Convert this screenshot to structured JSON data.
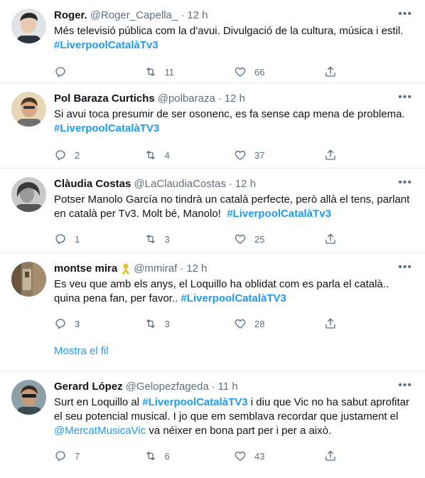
{
  "tweets": [
    {
      "name": "Roger.",
      "handle": "@Roger_Capella_",
      "dot": "·",
      "time": "12 h",
      "text_parts": [
        "Més televisió pública com la d'avui. Divulgació de la cultura, música i estil.\n"
      ],
      "hashtag": "#LiverpoolCatalàTv3",
      "replies": "",
      "retweets": "11",
      "likes": "66"
    },
    {
      "name": "Pol Baraza Curtichs",
      "handle": "@polbaraza",
      "dot": "·",
      "time": "12 h",
      "text_parts": [
        "Si avui toca presumir de ser osonenc, es fa sense cap mena de problema.\n"
      ],
      "hashtag": "#LiverpoolCatalàTV3",
      "replies": "2",
      "retweets": "4",
      "likes": "37"
    },
    {
      "name": "Clàudia Costas",
      "handle": "@LaClaudiaCostas",
      "dot": "·",
      "time": "12 h",
      "text_parts": [
        "Potser Manolo García no tindrà un català perfecte, però allà el tens, parlant en català per Tv3. Molt bé, Manolo!  "
      ],
      "hashtag": "#LiverpoolCatalàTv3",
      "replies": "1",
      "retweets": "3",
      "likes": "25"
    },
    {
      "name": "montse mira",
      "handle": "@mmiraf",
      "dot": "·",
      "time": "12 h",
      "text_parts": [
        "Es veu que amb els anys, el Loquillo ha oblidat com es parla el català.. quina pena fan, per favor.. "
      ],
      "hashtag": "#LiverpoolCatalàTV3",
      "replies": "3",
      "retweets": "3",
      "likes": "28"
    },
    {
      "name": "Gerard López",
      "handle": "@Gelopezfageda",
      "dot": "·",
      "time": "11 h",
      "text_before": "Surt en Loquillo al ",
      "hashtag": "#LiverpoolCatalàTV3",
      "text_middle": " i diu que Vic no ha sabut aprofitar el seu potencial musical. I jo que em semblava recordar que justament el ",
      "mention": "@MercatMusicaVic",
      "text_after": " va néixer en bona part per i per a això.",
      "replies": "7",
      "retweets": "6",
      "likes": "43"
    }
  ],
  "show_thread_label": "Mostra el fil",
  "colors": {
    "accent": "#1d9bf0",
    "muted": "#5b7083",
    "divider": "#e6ecf0",
    "ribbon": "#f5c518"
  },
  "icons": [
    "reply-icon",
    "retweet-icon",
    "like-icon",
    "share-icon",
    "more-options-icon",
    "yellow-ribbon-icon"
  ]
}
